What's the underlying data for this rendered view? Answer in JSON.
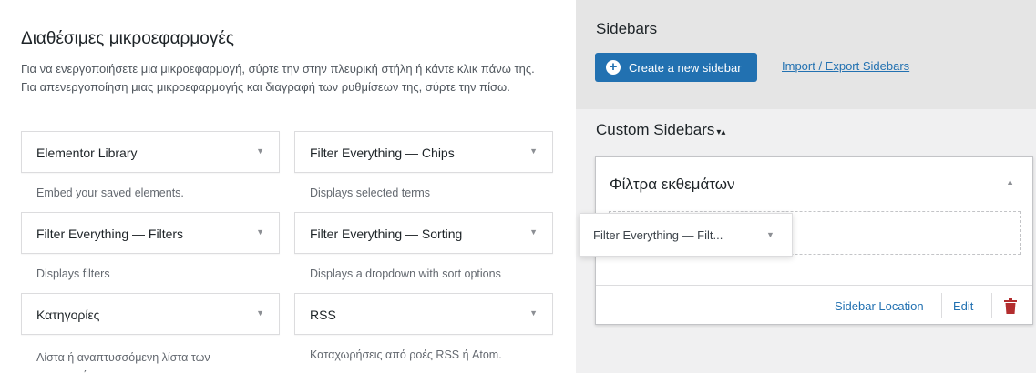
{
  "available": {
    "title": "Διαθέσιμες μικροεφαρμογές",
    "description": "Για να ενεργοποιήσετε μια μικροεφαρμογή, σύρτε την στην πλευρική στήλη ή κάντε κλικ πάνω της. Για απενεργοποίηση μιας μικροεφαρμογής και διαγραφή των ρυθμίσεων της, σύρτε την πίσω.",
    "widgets": [
      {
        "title": "Elementor Library",
        "desc": "Embed your saved elements."
      },
      {
        "title": "Filter Everything — Chips",
        "desc": "Displays selected terms"
      },
      {
        "title": "Filter Everything — Filters",
        "desc": "Displays filters"
      },
      {
        "title": "Filter Everything — Sorting",
        "desc": "Displays a dropdown with sort options"
      },
      {
        "title": "Κατηγορίες",
        "desc": "Λίστα ή αναπτυσσόμενη λίστα των κατηγοριών"
      },
      {
        "title": "RSS",
        "desc": "Καταχωρήσεις από ροές RSS ή Atom."
      }
    ],
    "expand_icon": "caret-down-icon"
  },
  "sidebars": {
    "title": "Sidebars",
    "create_button": "Create a new sidebar",
    "create_icon": "plus-circle-icon",
    "import_link": "Import / Export Sidebars",
    "custom_title": "Custom Sidebars",
    "sort_glyph": "▾▴",
    "custom_sidebar": {
      "name": "Φίλτρα εκθεμάτων",
      "toggle_glyph": "▲",
      "location_link": "Sidebar Location",
      "edit_link": "Edit",
      "delete_icon": "trash-icon"
    }
  },
  "dragging_widget": {
    "title": "Filter Everything — Filt..."
  },
  "colors": {
    "accent": "#2271b1",
    "danger": "#b32d2e"
  }
}
